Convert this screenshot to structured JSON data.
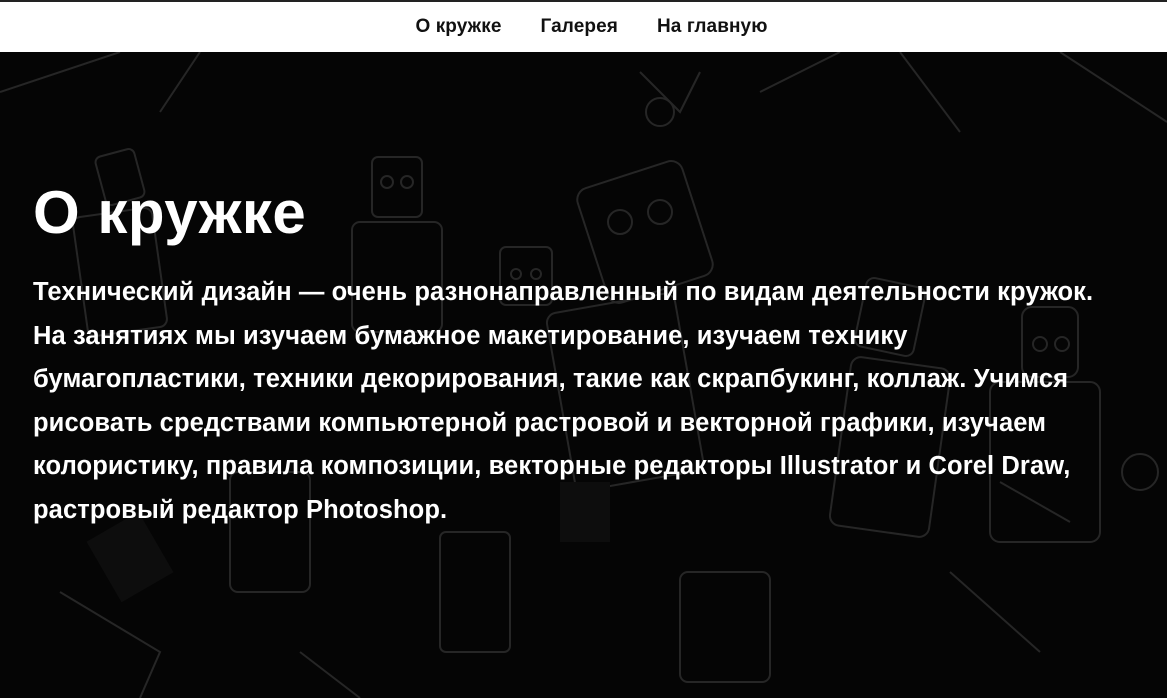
{
  "nav": {
    "items": [
      {
        "label": "О кружке"
      },
      {
        "label": "Галерея"
      },
      {
        "label": "На главную"
      }
    ]
  },
  "hero": {
    "title": "О кружке",
    "description": "Технический дизайн — очень разнонаправленный по видам деятельности кружок. На занятиях мы изучаем бумажное макетирование, изучаем технику бумагопластики, техники декорирования, такие как скрапбукинг, коллаж. Учимся рисовать средствами компьютерной растровой и векторной графики, изучаем колористику, правила композиции, векторные редакторы Illustrator и Corel Draw, растровый редактор Photoshop."
  },
  "colors": {
    "nav_background": "#ffffff",
    "nav_text": "#111111",
    "hero_background": "#050505",
    "hero_text": "#ffffff"
  }
}
